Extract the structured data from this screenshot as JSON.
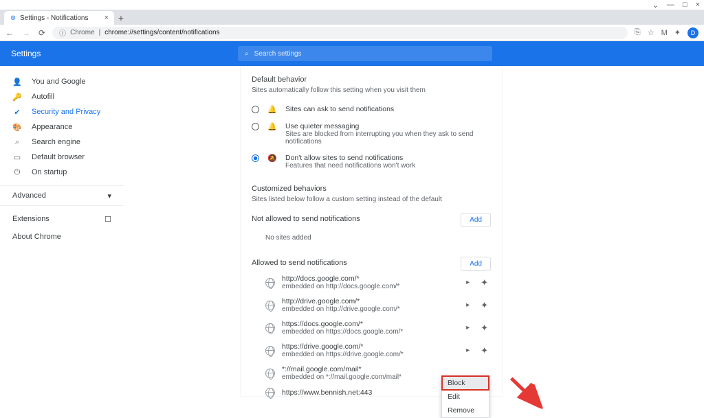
{
  "titleBar": {
    "min": "—",
    "max": "□",
    "close": "×",
    "chevron": "⌄"
  },
  "tab": {
    "title": "Settings - Notifications",
    "newTab": "+"
  },
  "addr": {
    "back": "←",
    "fwd": "→",
    "reload": "⟳",
    "chromeLabel": "Chrome",
    "sep": "|",
    "url": "chrome://settings/content/notifications"
  },
  "extIcons": {
    "cast": "⎘",
    "help": "?",
    "mail": "M",
    "puzzle": "✦",
    "avatar": "D"
  },
  "header": {
    "title": "Settings",
    "searchPlaceholder": "Search settings",
    "searchIcon": "⌕"
  },
  "sidebar": {
    "items": [
      {
        "icon": "👤",
        "label": "You and Google"
      },
      {
        "icon": "🔑",
        "label": "Autofill"
      },
      {
        "icon": "✔",
        "label": "Security and Privacy",
        "active": true
      },
      {
        "icon": "🎨",
        "label": "Appearance"
      },
      {
        "icon": "⌕",
        "label": "Search engine"
      },
      {
        "icon": "▭",
        "label": "Default browser"
      },
      {
        "icon": "⏻",
        "label": "On startup"
      }
    ],
    "advanced": "Advanced",
    "advChev": "▾",
    "extensions": "Extensions",
    "extIcon": "☐",
    "about": "About Chrome"
  },
  "content": {
    "defaultHead": "Default behavior",
    "defaultSub": "Sites automatically follow this setting when you visit them",
    "radios": [
      {
        "icon": "🔔",
        "t1": "Sites can ask to send notifications",
        "t2": "",
        "checked": false
      },
      {
        "icon": "🔔",
        "t1": "Use quieter messaging",
        "t2": "Sites are blocked from interrupting you when they ask to send notifications",
        "checked": false
      },
      {
        "icon": "🔕",
        "t1": "Don't allow sites to send notifications",
        "t2": "Features that need notifications won't work",
        "checked": true
      }
    ],
    "customHead": "Customized behaviors",
    "customSub": "Sites listed below follow a custom setting instead of the default",
    "notAllowedHead": "Not allowed to send notifications",
    "noSites": "No sites added",
    "allowedHead": "Allowed to send notifications",
    "addBtn": "Add",
    "sites": [
      {
        "s1": "http://docs.google.com/*",
        "s2": "embedded on http://docs.google.com/*"
      },
      {
        "s1": "http://drive.google.com/*",
        "s2": "embedded on http://drive.google.com/*"
      },
      {
        "s1": "https://docs.google.com/*",
        "s2": "embedded on https://docs.google.com/*"
      },
      {
        "s1": "https://drive.google.com/*",
        "s2": "embedded on https://drive.google.com/*"
      },
      {
        "s1": "*://mail.google.com/mail*",
        "s2": "embedded on *://mail.google.com/mail*"
      },
      {
        "s1": "https://www.bennish.net:443",
        "s2": ""
      }
    ],
    "chev": "▸",
    "puzzle": "✦"
  },
  "menu": {
    "block": "Block",
    "edit": "Edit",
    "remove": "Remove"
  }
}
